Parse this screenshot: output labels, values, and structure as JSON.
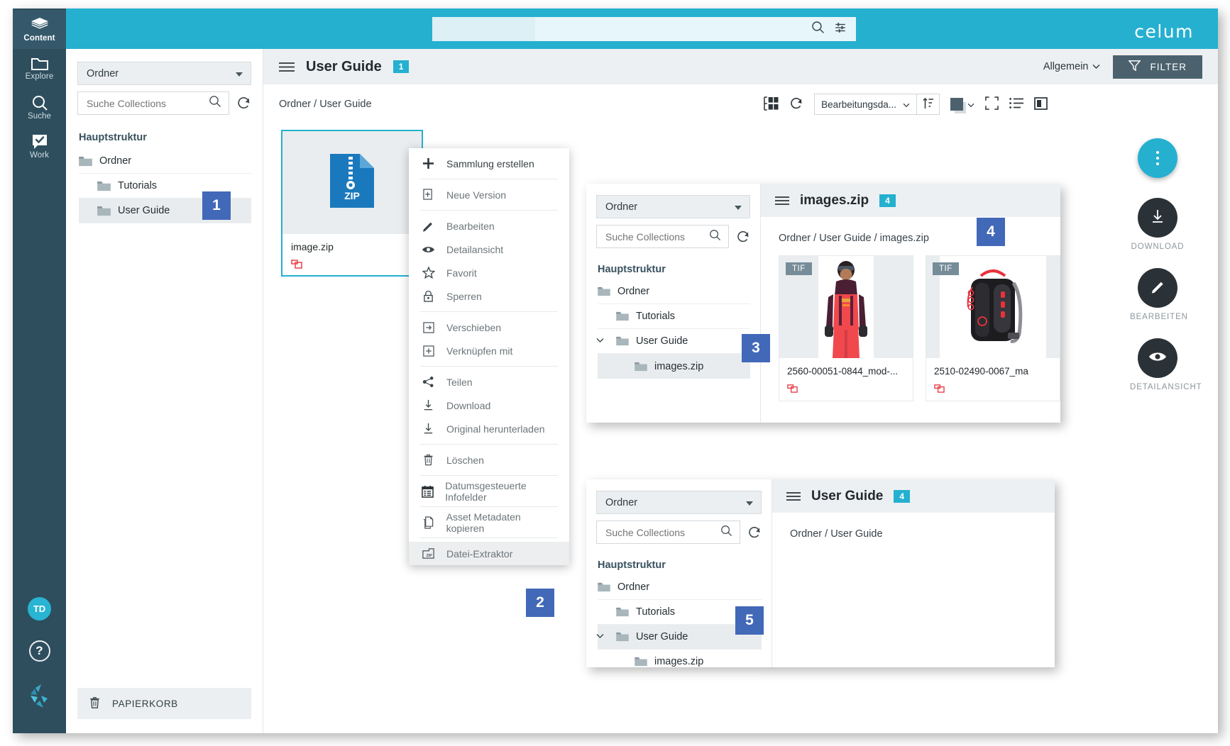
{
  "brand": {
    "logo_text": "celum",
    "accent": "#25b0d0",
    "dark": "#2e4e5e",
    "step_badge_color": "#4268b8"
  },
  "rail": {
    "items": [
      {
        "label": "Content",
        "icon": "layers-icon",
        "active": true
      },
      {
        "label": "Explore",
        "icon": "folder-icon",
        "active": false
      },
      {
        "label": "Suche",
        "icon": "search-icon",
        "active": false
      },
      {
        "label": "Work",
        "icon": "check-bubble-icon",
        "active": false
      }
    ],
    "avatar_initials": "TD",
    "help_label": "?"
  },
  "topbar": {
    "search_placeholder": "",
    "search_value": "",
    "search_icon": "search-icon",
    "filter_sliders_icon": "sliders-icon"
  },
  "sidebar": {
    "scope_select": "Ordner",
    "search_placeholder": "Suche Collections",
    "reload_icon": "refresh-icon",
    "tree_heading": "Hauptstruktur",
    "tree": [
      {
        "label": "Ordner",
        "indent": 1,
        "selected": false,
        "chevron": ""
      },
      {
        "label": "Tutorials",
        "indent": 2,
        "selected": false,
        "chevron": ""
      },
      {
        "label": "User Guide",
        "indent": 2,
        "selected": true,
        "chevron": ""
      }
    ],
    "trash_label": "PAPIERKORB",
    "trash_icon": "trash-icon"
  },
  "main": {
    "burger_icon": "hamburger-icon",
    "title": "User Guide",
    "count": "1",
    "context_label": "Allgemein",
    "filter_label": "FILTER",
    "filter_icon": "funnel-icon",
    "breadcrumb": "Ordner / User Guide",
    "toolbar": {
      "grid_icon": "thumbnail-grid-icon",
      "refresh_icon": "refresh-icon",
      "sort_field": "Bearbeitungsda...",
      "sort_direction_icon": "sort-asc-icon",
      "swatch_icon": "color-swatch-icon",
      "fullscreen_icon": "fullscreen-icon",
      "list-view_icon": "list-view-icon",
      "split-view_icon": "split-view-icon"
    },
    "fabs": [
      {
        "icon": "more-vertical-icon",
        "label": "",
        "style": "cyan"
      },
      {
        "icon": "download-icon",
        "label": "DOWNLOAD",
        "style": "dark"
      },
      {
        "icon": "pencil-icon",
        "label": "BEARBEITEN",
        "style": "dark"
      },
      {
        "icon": "eye-icon",
        "label": "DETAILANSICHT",
        "style": "dark"
      }
    ],
    "asset": {
      "name": "image.zip",
      "type_label": "ZIP",
      "flag_icon": "broken-link-icon"
    }
  },
  "context_menu": {
    "groups": [
      [
        {
          "label": "Sammlung erstellen",
          "icon": "plus-icon"
        }
      ],
      [
        {
          "label": "Neue Version",
          "icon": "file-plus-icon"
        }
      ],
      [
        {
          "label": "Bearbeiten",
          "icon": "pencil-icon"
        },
        {
          "label": "Detailansicht",
          "icon": "eye-icon"
        },
        {
          "label": "Favorit",
          "icon": "star-icon"
        },
        {
          "label": "Sperren",
          "icon": "lock-icon"
        }
      ],
      [
        {
          "label": "Verschieben",
          "icon": "move-arrow-icon"
        },
        {
          "label": "Verknüpfen mit",
          "icon": "link-plus-icon"
        }
      ],
      [
        {
          "label": "Teilen",
          "icon": "share-icon"
        },
        {
          "label": "Download",
          "icon": "download-icon"
        },
        {
          "label": "Original herunterladen",
          "icon": "download-icon"
        }
      ],
      [
        {
          "label": "Löschen",
          "icon": "trash-icon"
        }
      ],
      [
        {
          "label": "Datumsgesteuerte Infofelder",
          "icon": "calendar-icon"
        }
      ],
      [
        {
          "label": "Asset Metadaten kopieren",
          "icon": "copy-file-icon"
        }
      ],
      [
        {
          "label": "Datei-Extraktor",
          "icon": "zip-extract-icon",
          "highlighted": true
        }
      ]
    ]
  },
  "panel_images": {
    "scope_select": "Ordner",
    "search_placeholder": "Suche Collections",
    "reload_icon": "refresh-icon",
    "tree_heading": "Hauptstruktur",
    "tree": [
      {
        "label": "Ordner",
        "indent": 1,
        "selected": false,
        "expanded": null
      },
      {
        "label": "Tutorials",
        "indent": 2,
        "selected": false,
        "expanded": null
      },
      {
        "label": "User Guide",
        "indent": 2,
        "selected": false,
        "expanded": true
      },
      {
        "label": "images.zip",
        "indent": 3,
        "selected": true,
        "expanded": null
      }
    ],
    "title": "images.zip",
    "count": "4",
    "burger_icon": "hamburger-icon",
    "breadcrumb": "Ordner / User Guide / images.zip",
    "assets": [
      {
        "name": "2560-00051-0844_mod-...",
        "type_label": "TIF",
        "flag_icon": "broken-link-icon",
        "thumb": "skier-model"
      },
      {
        "name": "2510-02490-0067_ma",
        "type_label": "TIF",
        "flag_icon": "broken-link-icon",
        "thumb": "backpack"
      }
    ]
  },
  "panel_userguide": {
    "scope_select": "Ordner",
    "search_placeholder": "Suche Collections",
    "reload_icon": "refresh-icon",
    "tree_heading": "Hauptstruktur",
    "tree": [
      {
        "label": "Ordner",
        "indent": 1,
        "selected": false,
        "expanded": null
      },
      {
        "label": "Tutorials",
        "indent": 2,
        "selected": false,
        "expanded": null
      },
      {
        "label": "User Guide",
        "indent": 2,
        "selected": true,
        "expanded": true
      },
      {
        "label": "images.zip",
        "indent": 3,
        "selected": false,
        "expanded": null
      }
    ],
    "title": "User Guide",
    "count": "4",
    "burger_icon": "hamburger-icon",
    "breadcrumb": "Ordner / User Guide"
  },
  "steps": [
    {
      "n": "1"
    },
    {
      "n": "2"
    },
    {
      "n": "3"
    },
    {
      "n": "4"
    },
    {
      "n": "5"
    }
  ]
}
